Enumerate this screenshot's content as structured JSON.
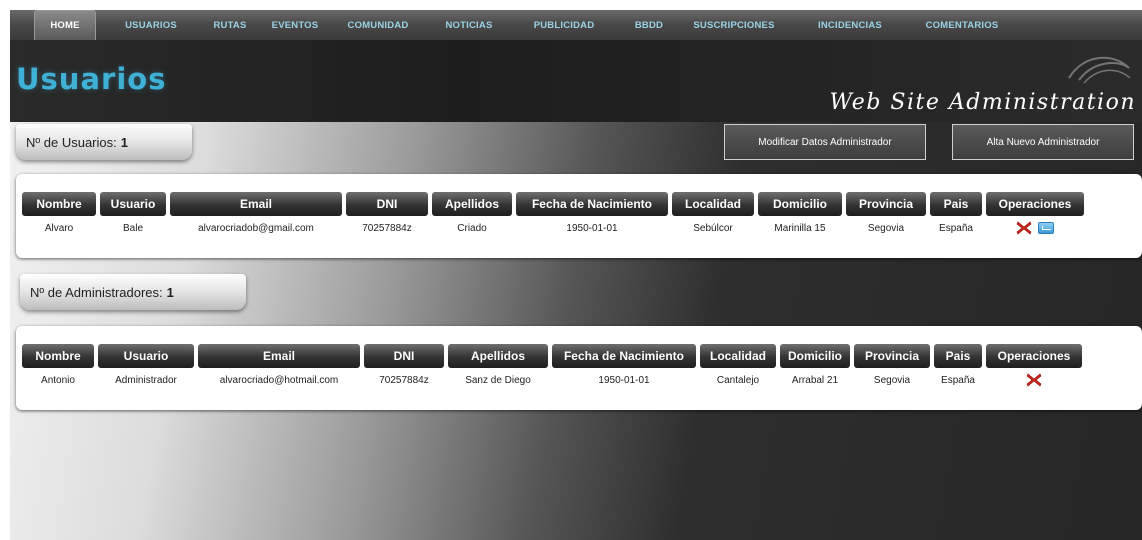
{
  "nav": {
    "items": [
      {
        "label": "HOME",
        "active": true
      },
      {
        "label": "USUARIOS"
      },
      {
        "label": "RUTAS"
      },
      {
        "label": "EVENTOS"
      },
      {
        "label": "COMUNIDAD"
      },
      {
        "label": "NOTICIAS"
      },
      {
        "label": "PUBLICIDAD"
      },
      {
        "label": "BBDD"
      },
      {
        "label": "SUSCRIPCIONES"
      },
      {
        "label": "INCIDENCIAS"
      },
      {
        "label": "COMENTARIOS"
      }
    ]
  },
  "header": {
    "title": "Usuarios",
    "subtitle": "Web Site Administration"
  },
  "users": {
    "count_label": "Nº de Usuarios:",
    "count_value": "1",
    "columns": [
      "Nombre",
      "Usuario",
      "Email",
      "DNI",
      "Apellidos",
      "Fecha de Nacimiento",
      "Localidad",
      "Domicilio",
      "Provincia",
      "Pais",
      "Operaciones"
    ],
    "rows": [
      [
        "Alvaro",
        "Bale",
        "alvarocriadob@gmail.com",
        "70257884z",
        "Criado",
        "1950-01-01",
        "Sebúlcor",
        "Marinilla 15",
        "Segovia",
        "España"
      ]
    ]
  },
  "admins": {
    "count_label": "Nº de Administradores:",
    "count_value": "1",
    "columns": [
      "Nombre",
      "Usuario",
      "Email",
      "DNI",
      "Apellidos",
      "Fecha de Nacimiento",
      "Localidad",
      "Domicilio",
      "Provincia",
      "Pais",
      "Operaciones"
    ],
    "rows": [
      [
        "Antonio",
        "Administrador",
        "alvarocriado@hotmail.com",
        "70257884z",
        "Sanz de Diego",
        "1950-01-01",
        "Cantalejo",
        "Arrabal 21",
        "Segovia",
        "España"
      ]
    ]
  },
  "buttons": {
    "modify_admin": "Modificar Datos Administrador",
    "new_admin": "Alta Nuevo Administrador"
  },
  "colors": {
    "title_accent": "#3fb0d6",
    "nav_text": "#9bd2e6",
    "delete_red": "#d0241c"
  },
  "icons": {
    "delete": "delete-x-icon",
    "edit": "mail-icon"
  }
}
